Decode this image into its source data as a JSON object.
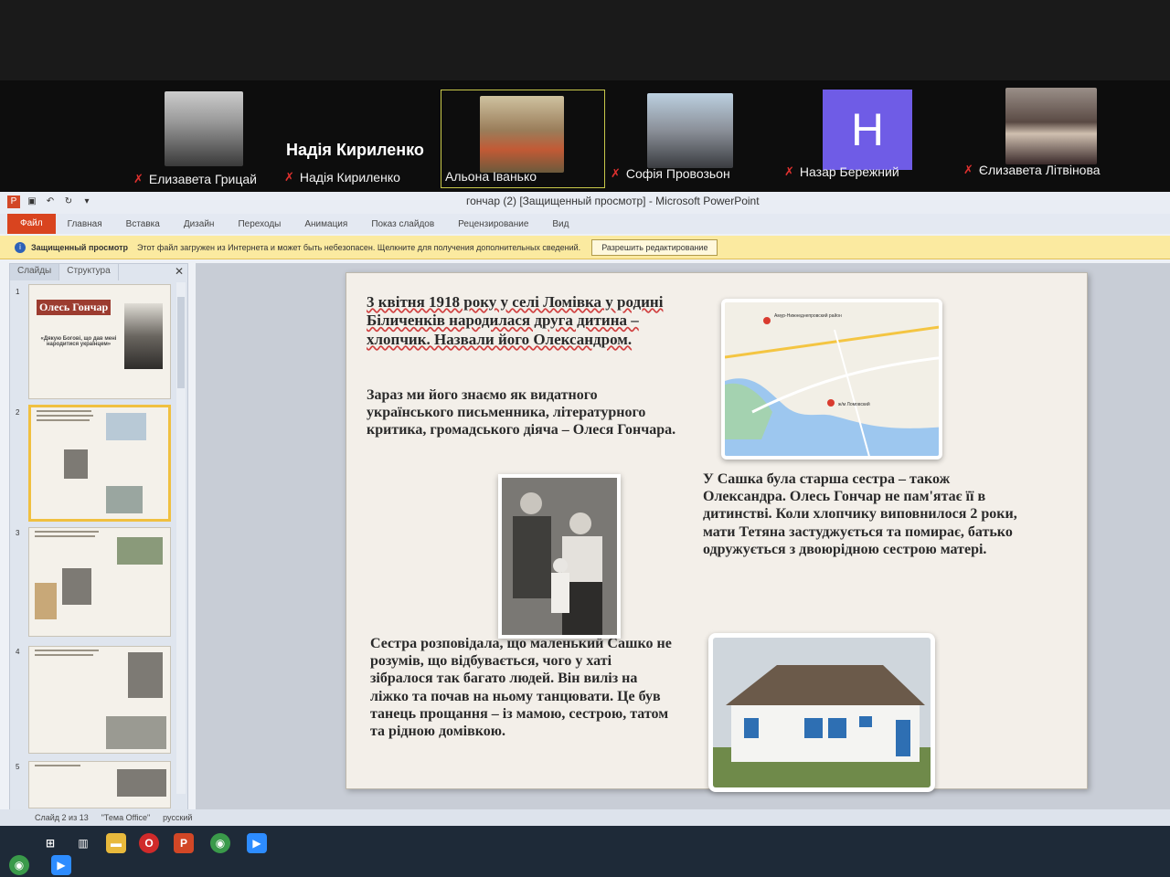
{
  "zoom": {
    "participants": [
      {
        "name": "Елизавета Грицай",
        "muted": true
      },
      {
        "name": "Надія Кириленко",
        "muted": true,
        "display_text": "Надія Кириленко"
      },
      {
        "name": "Альона Іванько",
        "muted": false,
        "active": true
      },
      {
        "name": "Софія Провозьон",
        "muted": true
      },
      {
        "name": "Назар Бережний",
        "muted": true,
        "avatar_letter": "H"
      },
      {
        "name": "Єлизавета Літвінова",
        "muted": true
      }
    ]
  },
  "powerpoint": {
    "window_title": "гончар (2) [Защищенный просмотр]  -  Microsoft PowerPoint",
    "tabs": [
      "Файл",
      "Главная",
      "Вставка",
      "Дизайн",
      "Переходы",
      "Анимация",
      "Показ слайдов",
      "Рецензирование",
      "Вид"
    ],
    "protected_view": {
      "label": "Защищенный просмотр",
      "message": "Этот файл загружен из Интернета и может быть небезопасен. Щелкните для получения дополнительных сведений.",
      "button": "Разрешить редактирование"
    },
    "panel_tabs": [
      "Слайды",
      "Структура"
    ],
    "thumbnails": [
      {
        "num": "1",
        "title": "Олесь Гончар",
        "quote": "«Дякую Богові, що дав мені народитися українцем»"
      },
      {
        "num": "2"
      },
      {
        "num": "3"
      },
      {
        "num": "4"
      },
      {
        "num": "5"
      }
    ],
    "status": {
      "slide": "Слайд 2 из 13",
      "theme": "\"Тема Office\"",
      "language": "русский"
    }
  },
  "slide": {
    "p1": "3 квітня 1918 року у селі Ломівка у родині Біличенків народилася друга дитина – хлопчик. Назвали його Олександром.",
    "p2": "Зараз ми його знаємо як видатного українського письменника, літературного критика, громадського діяча – Олеся Гончара.",
    "p3": "У Сашка була старша сестра – також Олександра. Олесь Гончар не пам'ятає її в дитинстві. Коли хлопчику виповнилося 2 роки, мати Тетяна застуджується та помирає, батько одружується з двоюрідною сестрою матері.",
    "p4": "Сестра розповідала, що маленький Сашко не розумів, що відбувається, чого у хаті зібралося так багато людей. Він виліз на ліжко та почав на ньому танцювати. Це був танець прощання – із мамою, сестрою, татом та рідною домівкою.",
    "map_labels": [
      "Амур-Нижнеднепровский район",
      "ж/м Ломовский"
    ]
  },
  "colors": {
    "file_tab": "#d9441f",
    "protected_bar": "#fbeaa0",
    "avatar": "#6f5ce6"
  }
}
